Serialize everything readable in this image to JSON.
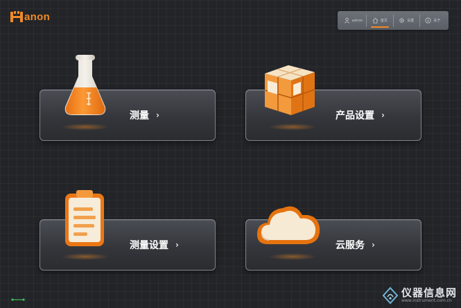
{
  "brand": {
    "name": "anon",
    "accent": "#f08a26"
  },
  "topbar": {
    "items": [
      {
        "icon": "user-icon",
        "label": "admin"
      },
      {
        "icon": "home-icon",
        "label": "首页"
      },
      {
        "icon": "gear-icon",
        "label": "设置"
      },
      {
        "icon": "info-icon",
        "label": "关于"
      }
    ],
    "active_index": 1
  },
  "menu": [
    {
      "label": "测量",
      "icon": "flask-icon"
    },
    {
      "label": "产品设置",
      "icon": "cube-icon"
    },
    {
      "label": "测量设置",
      "icon": "clipboard-icon"
    },
    {
      "label": "云服务",
      "icon": "cloud-icon"
    }
  ],
  "chevron": "›",
  "watermark": {
    "text": "仪器信息网",
    "url": "www.instrument.com.cn"
  }
}
